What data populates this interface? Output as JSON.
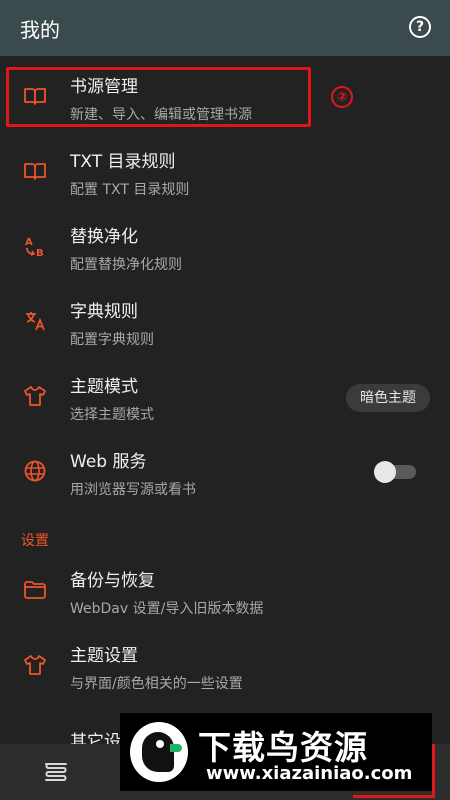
{
  "topbar": {
    "title": "我的",
    "help_icon": "help-circle-icon"
  },
  "annotation": {
    "circled_number": "②"
  },
  "items_top": [
    {
      "title": "书源管理",
      "subtitle": "新建、导入、编辑或管理书源",
      "icon": "book-open-icon"
    },
    {
      "title": "TXT 目录规则",
      "subtitle": "配置 TXT 目录规则",
      "icon": "book-open-icon"
    },
    {
      "title": "替换净化",
      "subtitle": "配置替换净化规则",
      "icon": "replace-ab-icon"
    },
    {
      "title": "字典规则",
      "subtitle": "配置字典规则",
      "icon": "translate-icon"
    },
    {
      "title": "主题模式",
      "subtitle": "选择主题模式",
      "icon": "tshirt-icon",
      "chip": "暗色主题"
    },
    {
      "title": "Web 服务",
      "subtitle": "用浏览器写源或看书",
      "icon": "globe-icon",
      "toggle": false
    }
  ],
  "section": {
    "header": "设置"
  },
  "items_settings": [
    {
      "title": "备份与恢复",
      "subtitle": "WebDav 设置/导入旧版本数据",
      "icon": "folder-icon"
    },
    {
      "title": "主题设置",
      "subtitle": "与界面/颜色相关的一些设置",
      "icon": "tshirt-icon"
    }
  ],
  "partial_item": {
    "title": "其它设"
  },
  "bottom_nav": {
    "icon": "bookshelf-icon"
  },
  "watermark": {
    "title": "下载鸟资源",
    "url": "www.xiazainiao.com"
  },
  "colors": {
    "accent": "#f0542a",
    "topbar": "#3a4a4d",
    "background": "#222222",
    "annotation_red": "#e0161b"
  }
}
